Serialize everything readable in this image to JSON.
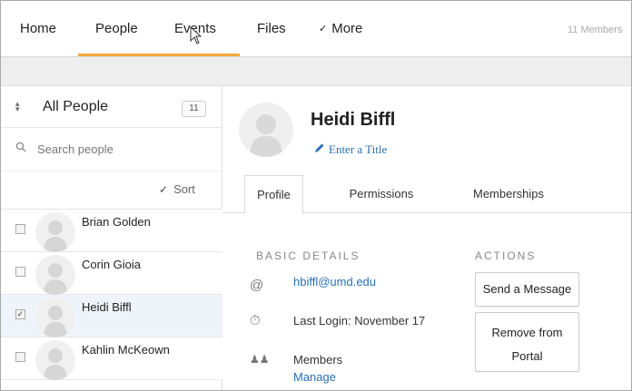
{
  "nav": {
    "items": [
      {
        "label": "Home"
      },
      {
        "label": "People"
      },
      {
        "label": "Events"
      },
      {
        "label": "Files"
      },
      {
        "label": "More"
      }
    ],
    "members_count": "11 Members",
    "active_color": "#f2a93b"
  },
  "sidebar": {
    "filter_label": "All People",
    "count": "11",
    "search_placeholder": "Search people",
    "sort_label": "Sort",
    "people": [
      {
        "name": "Brian Golden",
        "checked": false,
        "selected": false
      },
      {
        "name": "Corin Gioia",
        "checked": false,
        "selected": false
      },
      {
        "name": "Heidi Biffl",
        "checked": true,
        "selected": true
      },
      {
        "name": "Kahlin McKeown",
        "checked": false,
        "selected": false
      }
    ]
  },
  "profile": {
    "name": "Heidi Biffl",
    "title_link": "Enter a Title",
    "tabs": [
      {
        "label": "Profile",
        "active": true
      },
      {
        "label": "Permissions",
        "active": false
      },
      {
        "label": "Memberships",
        "active": false
      }
    ],
    "basic_details_heading": "BASIC DETAILS",
    "email": "hbiffl@umd.edu",
    "last_login": "Last Login: November 17",
    "members_label": "Members",
    "manage_link": "Manage",
    "actions_heading": "ACTIONS",
    "send_message_label": "Send a Message",
    "remove_line1": "Remove from",
    "remove_line2": "Portal"
  },
  "colors": {
    "link": "#2a6fb5",
    "selected_row": "#eef4fa"
  }
}
